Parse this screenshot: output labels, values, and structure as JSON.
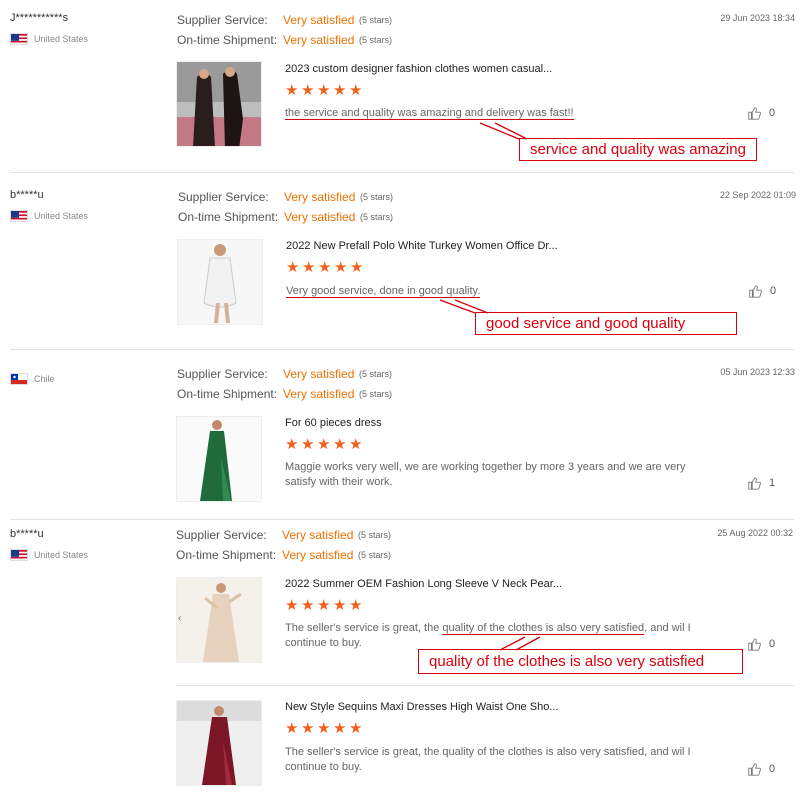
{
  "labels": {
    "supplier_service": "Supplier Service:",
    "ontime_shipment": "On-time Shipment:"
  },
  "reviews": [
    {
      "user": "J***********s",
      "country": "United States",
      "flag": "us",
      "supplier_rating": "Very satisfied",
      "supplier_stars": "(5 stars)",
      "shipment_rating": "Very satisfied",
      "shipment_stars": "(5 stars)",
      "date": "29 Jun 2023 18:34",
      "product_title": "2023 custom designer fashion clothes women casual...",
      "product_stars": 5,
      "comment": "the service and quality was amazing and delivery was fast!!",
      "likes": "0",
      "annotation": "service and quality was amazing"
    },
    {
      "user": "b*****u",
      "country": "United States",
      "flag": "us",
      "supplier_rating": "Very satisfied",
      "supplier_stars": "(5 stars)",
      "shipment_rating": "Very satisfied",
      "shipment_stars": "(5 stars)",
      "date": "22 Sep 2022 01:09",
      "product_title": "2022 New Prefall Polo White Turkey Women Office Dr...",
      "product_stars": 5,
      "comment": "Very good service, done in good quality.",
      "likes": "0",
      "annotation": "good service and good quality"
    },
    {
      "user": "",
      "country": "Chile",
      "flag": "cl",
      "supplier_rating": "Very satisfied",
      "supplier_stars": "(5 stars)",
      "shipment_rating": "Very satisfied",
      "shipment_stars": "(5 stars)",
      "date": "05 Jun 2023 12:33",
      "product_title": "For 60 pieces dress",
      "product_stars": 5,
      "comment": "Maggie works very well, we are working together by more 3 years and we are very satisfy with their work.",
      "likes": "1"
    },
    {
      "user": "b*****u",
      "country": "United States",
      "flag": "us",
      "supplier_rating": "Very satisfied",
      "supplier_stars": "(5 stars)",
      "shipment_rating": "Very satisfied",
      "shipment_stars": "(5 stars)",
      "date": "25 Aug 2022 00:32",
      "products": [
        {
          "title": "2022 Summer OEM Fashion Long Sleeve V Neck Pear...",
          "stars": 5,
          "comment_a": "The seller's service is great, the ",
          "comment_b": "quality of the clothes is also very satisfied",
          "comment_c": ", and wil I continue to buy.",
          "likes": "0",
          "annotation": "quality of the clothes is also very satisfied"
        },
        {
          "title": "New Style Sequins Maxi Dresses High Waist One Sho...",
          "stars": 5,
          "comment": "The seller's service is great, the quality of the clothes is also very satisfied, and wil I continue to buy.",
          "likes": "0"
        }
      ]
    }
  ],
  "colors": {
    "accent": "#ee7100",
    "star": "#f0611c",
    "annotation": "#d8000c"
  }
}
